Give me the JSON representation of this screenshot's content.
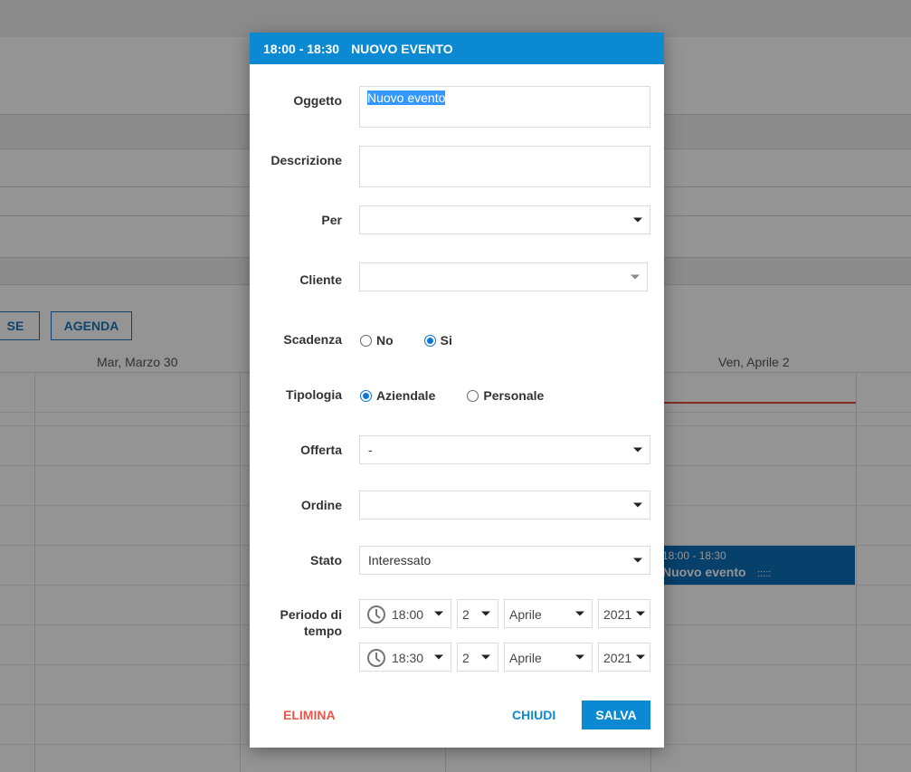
{
  "calendar": {
    "view_buttons": [
      "SE",
      "AGENDA"
    ],
    "day_headers": [
      "Mar, Marzo 30",
      "Ven, Aprile 2"
    ],
    "event": {
      "time": "18:00 - 18:30",
      "title": "Nuovo evento",
      "grip": ":::::"
    }
  },
  "dialog": {
    "header_time": "18:00 - 18:30",
    "header_title": "NUOVO EVENTO",
    "fields": {
      "oggetto": {
        "label": "Oggetto",
        "value": "Nuovo evento"
      },
      "descrizione": {
        "label": "Descrizione",
        "value": ""
      },
      "per": {
        "label": "Per",
        "value": ""
      },
      "cliente": {
        "label": "Cliente",
        "value": ""
      },
      "scadenza": {
        "label": "Scadenza",
        "options": [
          "No",
          "Si"
        ],
        "selected": "Si"
      },
      "tipologia": {
        "label": "Tipologia",
        "options": [
          "Aziendale",
          "Personale"
        ],
        "selected": "Aziendale"
      },
      "offerta": {
        "label": "Offerta",
        "value": "-"
      },
      "ordine": {
        "label": "Ordine",
        "value": ""
      },
      "stato": {
        "label": "Stato",
        "value": "Interessato"
      },
      "periodo": {
        "label_line1": "Periodo di",
        "label_line2": "tempo",
        "start": {
          "time": "18:00",
          "day": "2",
          "month": "Aprile",
          "year": "2021"
        },
        "end": {
          "time": "18:30",
          "day": "2",
          "month": "Aprile",
          "year": "2021"
        }
      }
    },
    "buttons": {
      "elimina": "ELIMINA",
      "chiudi": "CHIUDI",
      "salva": "SALVA"
    }
  },
  "colors": {
    "accent": "#0b89d3",
    "danger": "#e8574a",
    "event": "#0d6fb8",
    "now_line": "#e74c3c"
  }
}
